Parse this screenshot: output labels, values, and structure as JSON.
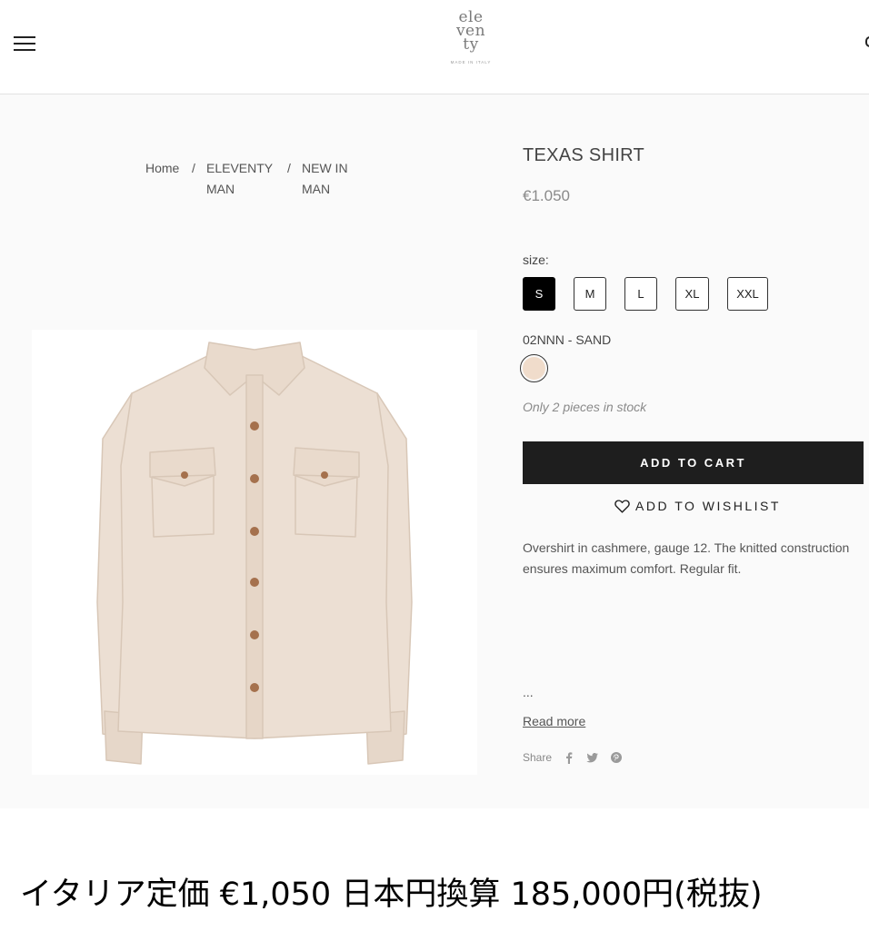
{
  "header": {
    "logo_lines": [
      "ele",
      "ven",
      "ty"
    ],
    "logo_tagline": "MADE IN ITALY"
  },
  "breadcrumb": {
    "items": [
      "Home",
      "ELEVENTY MAN",
      "NEW IN MAN"
    ],
    "separator": "/"
  },
  "product": {
    "title": "TEXAS SHIRT",
    "price": "€1.050",
    "size_label": "size:",
    "sizes": [
      "S",
      "M",
      "L",
      "XL",
      "XXL"
    ],
    "selected_size": "S",
    "color_label": "02NNN - SAND",
    "swatch_color": "#f0dccb",
    "stock_text": "Only 2 pieces in stock",
    "add_to_cart_label": "ADD TO CART",
    "wishlist_label": "ADD TO WISHLIST",
    "description": "Overshirt in cashmere, gauge 12. The knitted construction ensures maximum comfort. Regular fit.",
    "ellipsis": "...",
    "read_more_label": "Read more",
    "share_label": "Share",
    "share_icons": [
      "facebook-icon",
      "twitter-icon",
      "pinterest-icon"
    ],
    "shirt_color": "#ecdfd3"
  },
  "caption": {
    "text": "イタリア定価 €1,050 日本円換算 185,000円(税抜)"
  }
}
